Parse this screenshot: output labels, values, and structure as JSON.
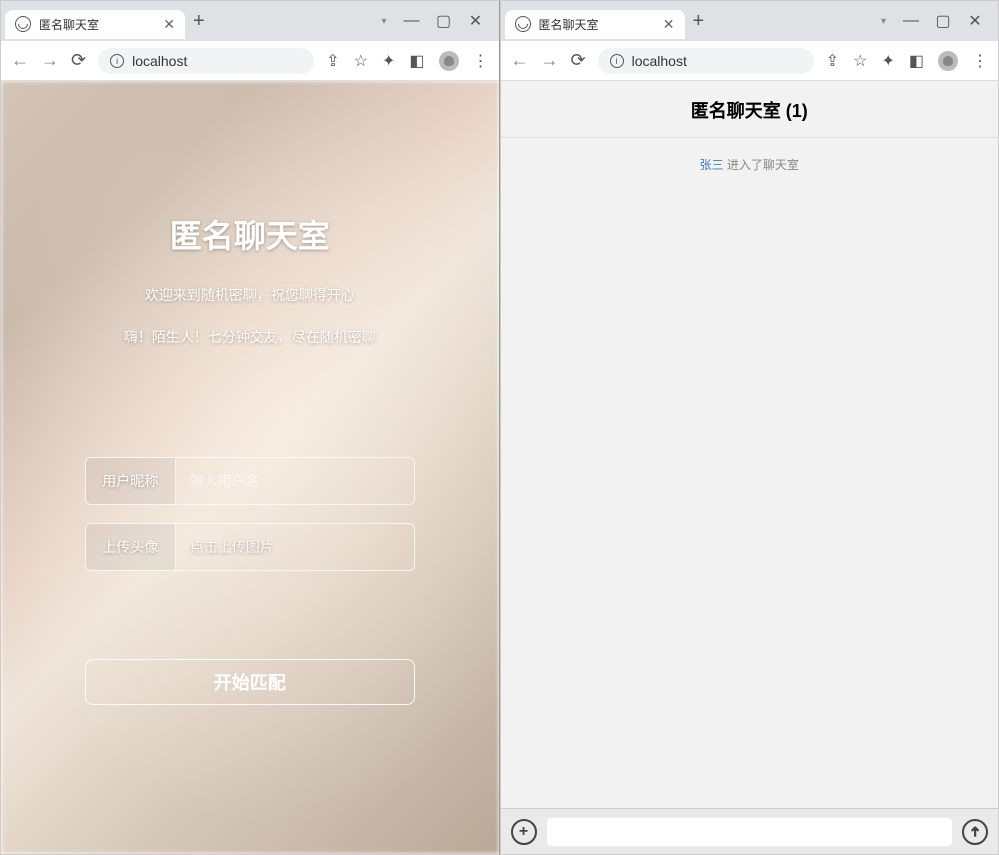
{
  "left": {
    "tab_title": "匿名聊天室",
    "url": "localhost",
    "page": {
      "title": "匿名聊天室",
      "subtitle1": "欢迎来到随机密聊，祝您聊得开心",
      "subtitle2": "嗨！陌生人！七分钟交友，尽在随机密聊",
      "nickname_label": "用户昵称",
      "nickname_placeholder": "输入用户名",
      "avatar_label": "上传头像",
      "avatar_hint": "点击上传图片",
      "start_label": "开始匹配"
    }
  },
  "right": {
    "tab_title": "匿名聊天室",
    "url": "localhost",
    "chat": {
      "header": "匿名聊天室 (1)",
      "system_user": "张三",
      "system_text": " 进入了聊天室"
    }
  }
}
